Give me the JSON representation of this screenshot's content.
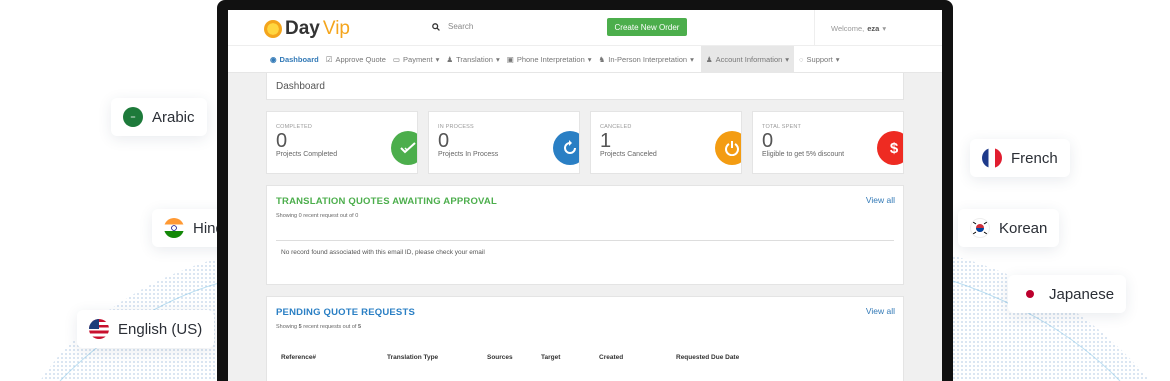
{
  "languages": {
    "arabic": "Arabic",
    "hindi": "Hind",
    "english": "English (US)",
    "french": "French",
    "korean": "Korean",
    "japanese": "Japanese"
  },
  "app": {
    "logo_day": "Day",
    "logo_vip": "Vip",
    "search_placeholder": "Search",
    "create_button": "Create New Order",
    "welcome_prefix": "Welcome,",
    "welcome_user": "eza"
  },
  "nav": [
    {
      "label": "Dashboard",
      "icon": "dashboard-icon"
    },
    {
      "label": "Approve Quote",
      "icon": "edit-icon"
    },
    {
      "label": "Payment",
      "icon": "credit-card-icon"
    },
    {
      "label": "Translation",
      "icon": "user-icon"
    },
    {
      "label": "Phone Interpretation",
      "icon": "phone-icon"
    },
    {
      "label": "In-Person Interpretation",
      "icon": "users-icon"
    },
    {
      "label": "Account Information",
      "icon": "user-icon"
    },
    {
      "label": "Support",
      "icon": "chat-icon"
    }
  ],
  "breadcrumb": "Dashboard",
  "stats": [
    {
      "label": "COMPLETED",
      "value": "0",
      "sub": "Projects Completed",
      "color": "#4cae4c",
      "icon": "check-icon"
    },
    {
      "label": "IN PROCESS",
      "value": "0",
      "sub": "Projects In Process",
      "color": "#2a7fc4",
      "icon": "refresh-icon"
    },
    {
      "label": "CANCELED",
      "value": "1",
      "sub": "Projects Canceled",
      "color": "#f39c12",
      "icon": "power-icon"
    },
    {
      "label": "TOTAL SPENT",
      "value": "0",
      "sub": "Eligible to get 5% discount",
      "color": "#ee2b22",
      "icon": "dollar-icon"
    }
  ],
  "quotes_panel": {
    "title": "TRANSLATION QUOTES AWAITING APPROVAL",
    "title_color": "#4cae4c",
    "view_all": "View all",
    "showing": "Showing 0 recent request out of 0",
    "empty": "No record found associated with this email ID, please check your email"
  },
  "pending_panel": {
    "title": "PENDING QUOTE REQUESTS",
    "title_color": "#2a7fc4",
    "view_all": "View all",
    "showing_prefix": "Showing",
    "showing_count": "5",
    "showing_middle": "recent requests out of",
    "showing_total": "5",
    "columns": [
      "Reference#",
      "Translation Type",
      "Sources",
      "Target",
      "Created",
      "Requested Due Date"
    ]
  }
}
